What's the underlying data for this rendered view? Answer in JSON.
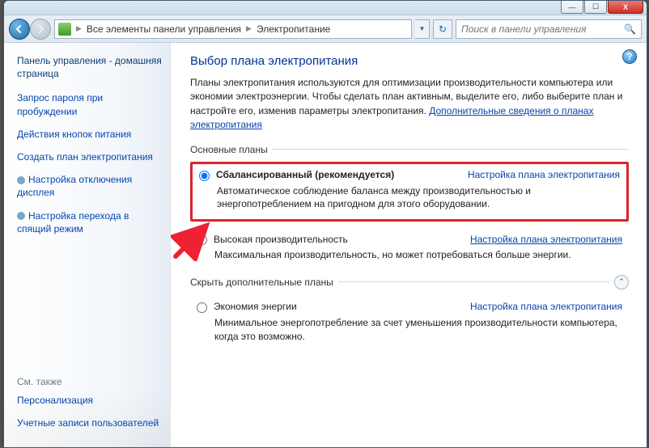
{
  "titlebar": {
    "min": "—",
    "max": "☐",
    "close": "X"
  },
  "nav": {
    "crumb1": "Все элементы панели управления",
    "crumb2": "Электропитание",
    "search_placeholder": "Поиск в панели управления"
  },
  "sidebar": {
    "home": "Панель управления - домашняя страница",
    "links": [
      "Запрос пароля при пробуждении",
      "Действия кнопок питания",
      "Создать план электропитания",
      "Настройка отключения дисплея",
      "Настройка перехода в спящий режим"
    ],
    "seealso_title": "См. также",
    "seealso": [
      "Персонализация",
      "Учетные записи пользователей"
    ]
  },
  "main": {
    "heading": "Выбор плана электропитания",
    "intro_a": "Планы электропитания используются для оптимизации производительности компьютера или экономии электроэнергии. Чтобы сделать план активным, выделите его, либо выберите план и настройте его, изменив параметры электропитания. ",
    "intro_link": "Дополнительные сведения о планах электропитания",
    "group_main": "Основные планы",
    "group_extra": "Скрыть дополнительные планы",
    "plan_cfg": "Настройка плана электропитания",
    "plans": {
      "balanced": {
        "title": "Сбалансированный (рекомендуется)",
        "desc": "Автоматическое соблюдение баланса между производительностью и энергопотреблением на пригодном для этого оборудовании."
      },
      "high": {
        "title": "Высокая производительность",
        "desc": "Максимальная производительность, но может потребоваться больше энергии."
      },
      "eco": {
        "title": "Экономия энергии",
        "desc": "Минимальное энергопотребление за счет уменьшения производительности компьютера, когда это возможно."
      }
    }
  }
}
